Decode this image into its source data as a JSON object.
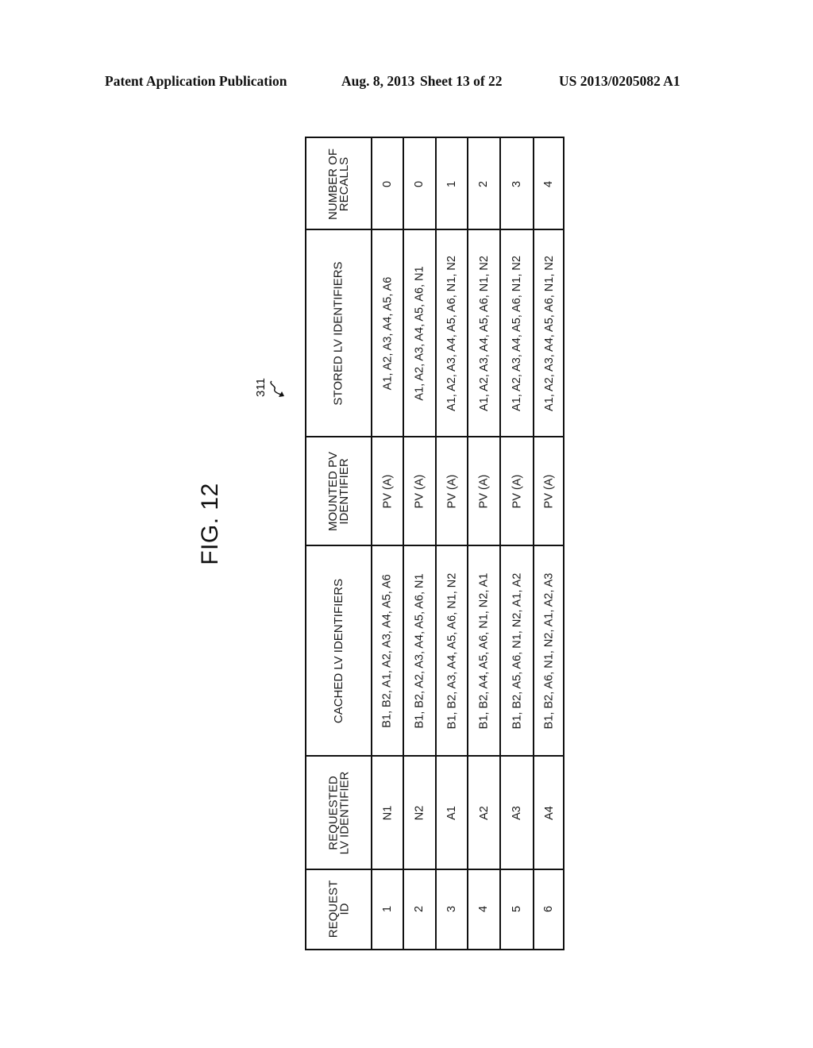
{
  "header": {
    "publication": "Patent Application Publication",
    "date": "Aug. 8, 2013",
    "sheet": "Sheet 13 of 22",
    "number": "US 2013/0205082 A1"
  },
  "figure": {
    "title": "FIG. 12",
    "reference": "311"
  },
  "table": {
    "columns": [
      {
        "key": "request_id",
        "label": "REQUEST\nID"
      },
      {
        "key": "requested_lv",
        "label": "REQUESTED\nLV IDENTIFIER"
      },
      {
        "key": "cached_lv",
        "label": "CACHED LV IDENTIFIERS"
      },
      {
        "key": "mounted_pv",
        "label": "MOUNTED PV\nIDENTIFIER"
      },
      {
        "key": "stored_lv",
        "label": "STORED LV IDENTIFIERS"
      },
      {
        "key": "recalls",
        "label": "NUMBER OF\nRECALLS"
      }
    ],
    "rows": [
      {
        "request_id": "1",
        "requested_lv": "N1",
        "cached_lv": "B1, B2, A1, A2, A3, A4, A5, A6",
        "mounted_pv": "PV (A)",
        "stored_lv": "A1, A2, A3, A4, A5, A6",
        "recalls": "0"
      },
      {
        "request_id": "2",
        "requested_lv": "N2",
        "cached_lv": "B1, B2, A2, A3, A4, A5, A6, N1",
        "mounted_pv": "PV (A)",
        "stored_lv": "A1, A2, A3, A4, A5, A6, N1",
        "recalls": "0"
      },
      {
        "request_id": "3",
        "requested_lv": "A1",
        "cached_lv": "B1, B2, A3, A4, A5, A6, N1, N2",
        "mounted_pv": "PV (A)",
        "stored_lv": "A1, A2, A3, A4, A5, A6, N1, N2",
        "recalls": "1"
      },
      {
        "request_id": "4",
        "requested_lv": "A2",
        "cached_lv": "B1, B2, A4, A5, A6, N1, N2, A1",
        "mounted_pv": "PV (A)",
        "stored_lv": "A1, A2, A3, A4, A5, A6, N1, N2",
        "recalls": "2"
      },
      {
        "request_id": "5",
        "requested_lv": "A3",
        "cached_lv": "B1, B2, A5, A6, N1, N2, A1, A2",
        "mounted_pv": "PV (A)",
        "stored_lv": "A1, A2, A3, A4, A5, A6, N1, N2",
        "recalls": "3"
      },
      {
        "request_id": "6",
        "requested_lv": "A4",
        "cached_lv": "B1, B2, A6, N1, N2, A1, A2, A3",
        "mounted_pv": "PV (A)",
        "stored_lv": "A1, A2, A3, A4, A5, A6, N1, N2",
        "recalls": "4"
      }
    ]
  }
}
